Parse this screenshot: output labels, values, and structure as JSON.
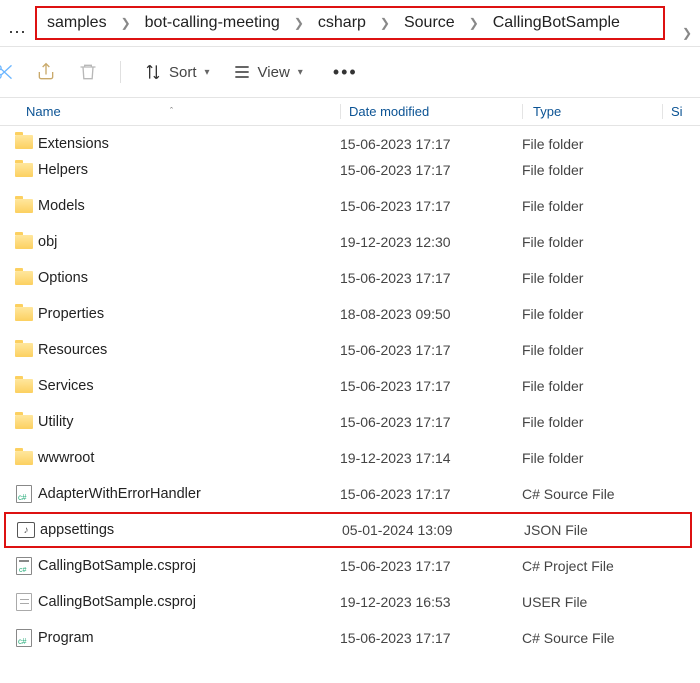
{
  "breadcrumb": {
    "items": [
      "samples",
      "bot-calling-meeting",
      "csharp",
      "Source",
      "CallingBotSample"
    ]
  },
  "toolbar": {
    "sort_label": "Sort",
    "view_label": "View"
  },
  "columns": {
    "name": "Name",
    "date": "Date modified",
    "type": "Type",
    "size": "Si"
  },
  "files": [
    {
      "icon": "folder",
      "name": "Extensions",
      "date": "15-06-2023 17:17",
      "type": "File folder",
      "cut": true
    },
    {
      "icon": "folder",
      "name": "Helpers",
      "date": "15-06-2023 17:17",
      "type": "File folder"
    },
    {
      "icon": "folder",
      "name": "Models",
      "date": "15-06-2023 17:17",
      "type": "File folder"
    },
    {
      "icon": "folder",
      "name": "obj",
      "date": "19-12-2023 12:30",
      "type": "File folder"
    },
    {
      "icon": "folder",
      "name": "Options",
      "date": "15-06-2023 17:17",
      "type": "File folder"
    },
    {
      "icon": "folder",
      "name": "Properties",
      "date": "18-08-2023 09:50",
      "type": "File folder"
    },
    {
      "icon": "folder",
      "name": "Resources",
      "date": "15-06-2023 17:17",
      "type": "File folder"
    },
    {
      "icon": "folder",
      "name": "Services",
      "date": "15-06-2023 17:17",
      "type": "File folder"
    },
    {
      "icon": "folder",
      "name": "Utility",
      "date": "15-06-2023 17:17",
      "type": "File folder"
    },
    {
      "icon": "folder",
      "name": "wwwroot",
      "date": "19-12-2023 17:14",
      "type": "File folder"
    },
    {
      "icon": "cs",
      "name": "AdapterWithErrorHandler",
      "date": "15-06-2023 17:17",
      "type": "C# Source File"
    },
    {
      "icon": "json",
      "name": "appsettings",
      "date": "05-01-2024 13:09",
      "type": "JSON File",
      "highlight": true
    },
    {
      "icon": "proj",
      "name": "CallingBotSample.csproj",
      "date": "15-06-2023 17:17",
      "type": "C# Project File"
    },
    {
      "icon": "user",
      "name": "CallingBotSample.csproj",
      "date": "19-12-2023 16:53",
      "type": "USER File"
    },
    {
      "icon": "cs",
      "name": "Program",
      "date": "15-06-2023 17:17",
      "type": "C# Source File"
    }
  ]
}
